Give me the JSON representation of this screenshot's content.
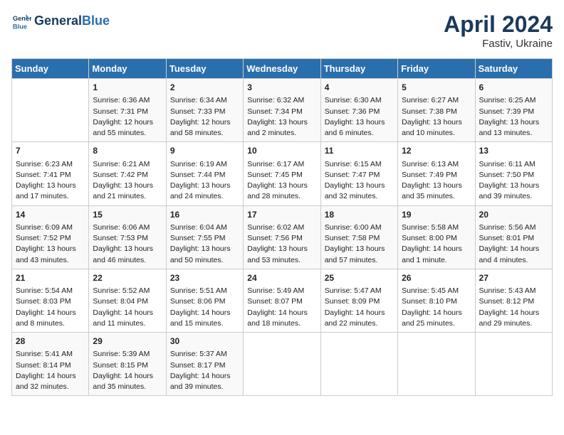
{
  "header": {
    "logo_line1": "General",
    "logo_line2": "Blue",
    "month_year": "April 2024",
    "location": "Fastiv, Ukraine"
  },
  "days_of_week": [
    "Sunday",
    "Monday",
    "Tuesday",
    "Wednesday",
    "Thursday",
    "Friday",
    "Saturday"
  ],
  "weeks": [
    [
      {
        "day": "",
        "info": ""
      },
      {
        "day": "1",
        "info": "Sunrise: 6:36 AM\nSunset: 7:31 PM\nDaylight: 12 hours\nand 55 minutes."
      },
      {
        "day": "2",
        "info": "Sunrise: 6:34 AM\nSunset: 7:33 PM\nDaylight: 12 hours\nand 58 minutes."
      },
      {
        "day": "3",
        "info": "Sunrise: 6:32 AM\nSunset: 7:34 PM\nDaylight: 13 hours\nand 2 minutes."
      },
      {
        "day": "4",
        "info": "Sunrise: 6:30 AM\nSunset: 7:36 PM\nDaylight: 13 hours\nand 6 minutes."
      },
      {
        "day": "5",
        "info": "Sunrise: 6:27 AM\nSunset: 7:38 PM\nDaylight: 13 hours\nand 10 minutes."
      },
      {
        "day": "6",
        "info": "Sunrise: 6:25 AM\nSunset: 7:39 PM\nDaylight: 13 hours\nand 13 minutes."
      }
    ],
    [
      {
        "day": "7",
        "info": "Sunrise: 6:23 AM\nSunset: 7:41 PM\nDaylight: 13 hours\nand 17 minutes."
      },
      {
        "day": "8",
        "info": "Sunrise: 6:21 AM\nSunset: 7:42 PM\nDaylight: 13 hours\nand 21 minutes."
      },
      {
        "day": "9",
        "info": "Sunrise: 6:19 AM\nSunset: 7:44 PM\nDaylight: 13 hours\nand 24 minutes."
      },
      {
        "day": "10",
        "info": "Sunrise: 6:17 AM\nSunset: 7:45 PM\nDaylight: 13 hours\nand 28 minutes."
      },
      {
        "day": "11",
        "info": "Sunrise: 6:15 AM\nSunset: 7:47 PM\nDaylight: 13 hours\nand 32 minutes."
      },
      {
        "day": "12",
        "info": "Sunrise: 6:13 AM\nSunset: 7:49 PM\nDaylight: 13 hours\nand 35 minutes."
      },
      {
        "day": "13",
        "info": "Sunrise: 6:11 AM\nSunset: 7:50 PM\nDaylight: 13 hours\nand 39 minutes."
      }
    ],
    [
      {
        "day": "14",
        "info": "Sunrise: 6:09 AM\nSunset: 7:52 PM\nDaylight: 13 hours\nand 43 minutes."
      },
      {
        "day": "15",
        "info": "Sunrise: 6:06 AM\nSunset: 7:53 PM\nDaylight: 13 hours\nand 46 minutes."
      },
      {
        "day": "16",
        "info": "Sunrise: 6:04 AM\nSunset: 7:55 PM\nDaylight: 13 hours\nand 50 minutes."
      },
      {
        "day": "17",
        "info": "Sunrise: 6:02 AM\nSunset: 7:56 PM\nDaylight: 13 hours\nand 53 minutes."
      },
      {
        "day": "18",
        "info": "Sunrise: 6:00 AM\nSunset: 7:58 PM\nDaylight: 13 hours\nand 57 minutes."
      },
      {
        "day": "19",
        "info": "Sunrise: 5:58 AM\nSunset: 8:00 PM\nDaylight: 14 hours\nand 1 minute."
      },
      {
        "day": "20",
        "info": "Sunrise: 5:56 AM\nSunset: 8:01 PM\nDaylight: 14 hours\nand 4 minutes."
      }
    ],
    [
      {
        "day": "21",
        "info": "Sunrise: 5:54 AM\nSunset: 8:03 PM\nDaylight: 14 hours\nand 8 minutes."
      },
      {
        "day": "22",
        "info": "Sunrise: 5:52 AM\nSunset: 8:04 PM\nDaylight: 14 hours\nand 11 minutes."
      },
      {
        "day": "23",
        "info": "Sunrise: 5:51 AM\nSunset: 8:06 PM\nDaylight: 14 hours\nand 15 minutes."
      },
      {
        "day": "24",
        "info": "Sunrise: 5:49 AM\nSunset: 8:07 PM\nDaylight: 14 hours\nand 18 minutes."
      },
      {
        "day": "25",
        "info": "Sunrise: 5:47 AM\nSunset: 8:09 PM\nDaylight: 14 hours\nand 22 minutes."
      },
      {
        "day": "26",
        "info": "Sunrise: 5:45 AM\nSunset: 8:10 PM\nDaylight: 14 hours\nand 25 minutes."
      },
      {
        "day": "27",
        "info": "Sunrise: 5:43 AM\nSunset: 8:12 PM\nDaylight: 14 hours\nand 29 minutes."
      }
    ],
    [
      {
        "day": "28",
        "info": "Sunrise: 5:41 AM\nSunset: 8:14 PM\nDaylight: 14 hours\nand 32 minutes."
      },
      {
        "day": "29",
        "info": "Sunrise: 5:39 AM\nSunset: 8:15 PM\nDaylight: 14 hours\nand 35 minutes."
      },
      {
        "day": "30",
        "info": "Sunrise: 5:37 AM\nSunset: 8:17 PM\nDaylight: 14 hours\nand 39 minutes."
      },
      {
        "day": "",
        "info": ""
      },
      {
        "day": "",
        "info": ""
      },
      {
        "day": "",
        "info": ""
      },
      {
        "day": "",
        "info": ""
      }
    ]
  ]
}
